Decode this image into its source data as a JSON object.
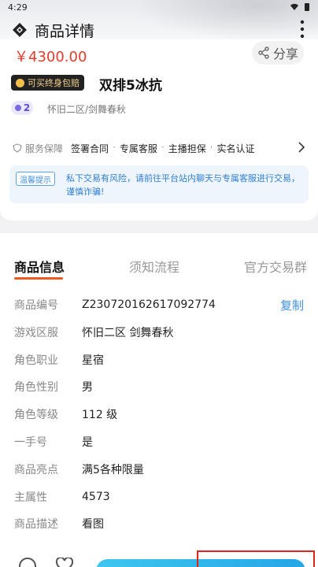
{
  "status_bar": {
    "time": "4:29"
  },
  "nav": {
    "title": "商品详情"
  },
  "product": {
    "price": "￥4300.00",
    "share_label": "分享",
    "badge_label": "可买终身包赔",
    "name": "双排5冰抗",
    "level": "2",
    "server": "怀旧二区/剑舞春秋"
  },
  "guarantee": {
    "label": "服务保障",
    "items": [
      "签署合同",
      "专属客服",
      "主播担保",
      "实名认证"
    ]
  },
  "tip": {
    "tag": "温馨提示",
    "text": "私下交易有风险，请前往平台站内聊天与专属客服进行交易，谨慎诈骗!"
  },
  "tabs": [
    "商品信息",
    "须知流程",
    "官方交易群"
  ],
  "details": [
    {
      "key": "商品编号",
      "value": "Z230720162617092774",
      "action": "复制"
    },
    {
      "key": "游戏区服",
      "value": "怀旧二区 剑舞春秋"
    },
    {
      "key": "角色职业",
      "value": "星宿"
    },
    {
      "key": "角色性别",
      "value": "男"
    },
    {
      "key": "角色等级",
      "value": "112 级"
    },
    {
      "key": "一手号",
      "value": "是"
    },
    {
      "key": "商品亮点",
      "value": "满5各种限量"
    },
    {
      "key": "主属性",
      "value": "4573"
    },
    {
      "key": "商品描述",
      "value": "看图"
    }
  ],
  "colors": {
    "price": "#e53b2c",
    "accent": "#f05a22",
    "link": "#3f8fe0"
  }
}
